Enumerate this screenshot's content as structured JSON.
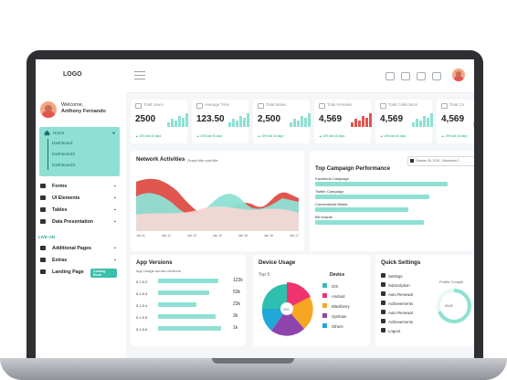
{
  "header": {
    "logo": "LOGO"
  },
  "sidebar": {
    "welcome": "Welcome,",
    "user_name": "Anthony Fernando",
    "home": {
      "label": "Home",
      "subitems": [
        "Dashboard",
        "Dashboard2",
        "Dashboard3"
      ]
    },
    "items": [
      {
        "label": "Forms",
        "icon": "document-icon"
      },
      {
        "label": "UI Elements",
        "icon": "grid-icon"
      },
      {
        "label": "Tables",
        "icon": "table-icon"
      },
      {
        "label": "Data Presentation",
        "icon": "chart-icon"
      }
    ],
    "section_label": "LIVE ON",
    "items2": [
      {
        "label": "Additional Pages",
        "icon": "pages-icon"
      },
      {
        "label": "Extras",
        "icon": "extras-icon"
      },
      {
        "label": "Landing Page",
        "icon": "landing-icon",
        "badge": "Coming Soon"
      }
    ]
  },
  "stats": [
    {
      "title": "Total Users",
      "value": "2500",
      "foot": "▲ 15% last 30 days"
    },
    {
      "title": "Average Time",
      "value": "123.50",
      "foot": "▲ 15% last 30 days"
    },
    {
      "title": "Total Males",
      "value": "2,500",
      "foot": "▲ 15% last 30 days"
    },
    {
      "title": "Total Females",
      "value": "4,569",
      "foot": "▲ 15% last 30 days"
    },
    {
      "title": "Total Collections",
      "value": "4,569",
      "foot": "▲ 15% last 30 days"
    },
    {
      "title": "Total Co",
      "value": "4,569",
      "foot": "▲ 15% last 30 days"
    }
  ],
  "network": {
    "title": "Network Activities",
    "subtitle": "Graph title sub-title",
    "x_labels": [
      "Jan 11",
      "Jan 12",
      "Jan 13",
      "Jan 14",
      "Jan 15",
      "Jan 16",
      "Jan 17"
    ]
  },
  "campaign": {
    "title": "Top Campaign Performance",
    "date_range": "October 26, 2015 - November 2",
    "items": [
      {
        "label": "Facebook Campaign",
        "value": 0.88
      },
      {
        "label": "Twitter Campaign",
        "value": 0.76
      },
      {
        "label": "Conventional Media",
        "value": 0.62
      },
      {
        "label": "Bill boards",
        "value": 0.72
      }
    ]
  },
  "app_versions": {
    "title": "App Versions",
    "subtitle": "App Usage across versions",
    "items": [
      {
        "label": "0.1.5.2",
        "value": "123k",
        "pct": 0.92
      },
      {
        "label": "0.1.5.3",
        "value": "53k",
        "pct": 0.78
      },
      {
        "label": "0.1.5.4",
        "value": "23k",
        "pct": 0.58
      },
      {
        "label": "0.1.5.5",
        "value": "3k",
        "pct": 0.88
      },
      {
        "label": "0.1.5.6",
        "value": "1k",
        "pct": 0.96
      }
    ]
  },
  "device": {
    "title": "Device Usage",
    "top_label": "Top 5",
    "legend_title": "Device",
    "items": [
      {
        "label": "IOS",
        "color": "#2fbfae"
      },
      {
        "label": "Android",
        "color": "#f0336e"
      },
      {
        "label": "Blackberry",
        "color": "#f6a623"
      },
      {
        "label": "Symbian",
        "color": "#8e44ad"
      },
      {
        "label": "Others",
        "color": "#20a8d8"
      }
    ],
    "center_label": "40%"
  },
  "quick": {
    "title": "Quick Settings",
    "items": [
      {
        "label": "Settings",
        "icon": "gear-icon"
      },
      {
        "label": "Subscription",
        "icon": "subscription-icon"
      },
      {
        "label": "Auto Renewal",
        "icon": "renewal-icon"
      },
      {
        "label": "Achievements",
        "icon": "achievement-icon"
      },
      {
        "label": "Auto Renewal",
        "icon": "renewal-icon"
      },
      {
        "label": "Achievements",
        "icon": "achievement-icon"
      },
      {
        "label": "Logout",
        "icon": "logout-icon"
      }
    ],
    "profile_label": "Profile Comple",
    "profile_value": "65/45"
  },
  "colors": {
    "accent": "#8ee0d4",
    "accent_dark": "#1aa892",
    "red": "#e0564f"
  }
}
